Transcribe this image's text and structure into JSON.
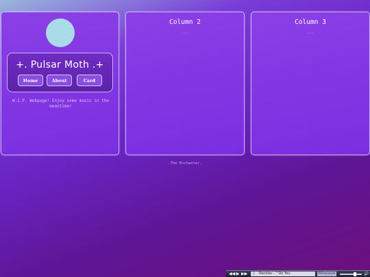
{
  "sidebar": {
    "title": "+. Pulsar Moth .+",
    "nav": [
      {
        "label": "Home"
      },
      {
        "label": "About"
      },
      {
        "label": "Card"
      }
    ],
    "note": "W.I.P. Webpage! Enjoy some music in the meantime!"
  },
  "columns": [
    {
      "title": "Column 2",
      "placeholder": "..."
    },
    {
      "title": "Column 3",
      "placeholder": "..."
    }
  ],
  "footer": {
    "credit": ".The Enchanter."
  },
  "player": {
    "track": "Necktar - \" Do You",
    "app_name": "Wikiplayer",
    "volume": 0.7,
    "icons": {
      "prev": "skip-back-icon",
      "play": "play-icon",
      "next": "skip-forward-icon",
      "volume": "speaker-icon"
    }
  },
  "colors": {
    "accent": "#8a4de0",
    "avatar": "#a9dbe8",
    "panel": "#7a2ee0"
  }
}
